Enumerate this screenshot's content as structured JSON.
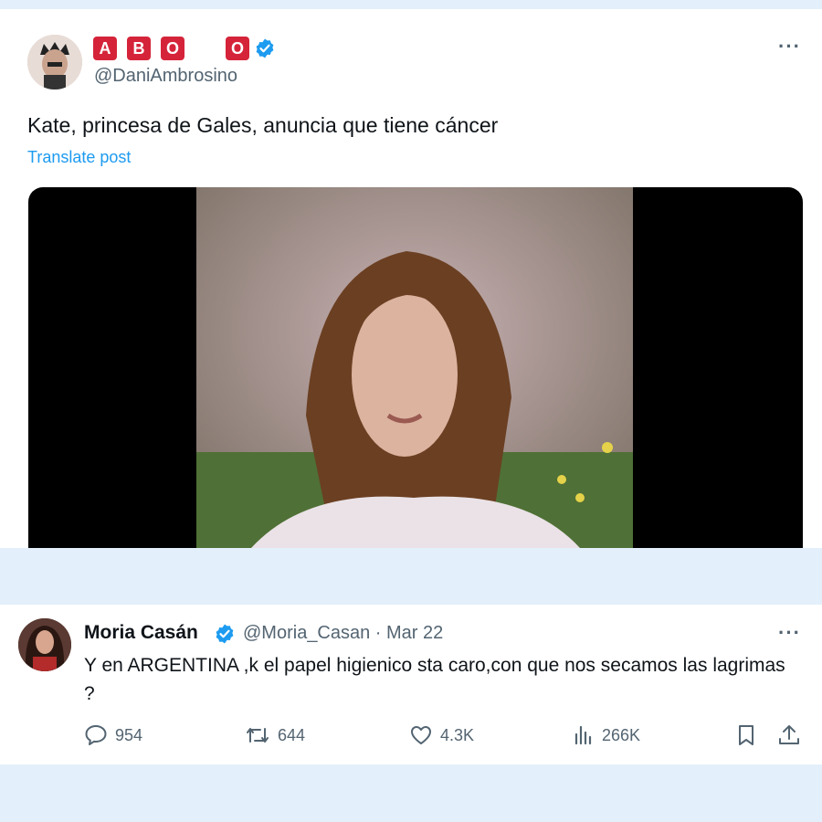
{
  "post": {
    "badges": [
      "A",
      "B",
      "O",
      "O"
    ],
    "handle": "@DaniAmbrosino",
    "text": "Kate, princesa de Gales, anuncia que tiene cáncer",
    "translate_label": "Translate post",
    "more_label": "···"
  },
  "reply": {
    "name": "Moria Casán",
    "handle_date": "@Moria_Casan · Mar 22",
    "text": "Y en ARGENTINA ,k el papel higienico sta caro,con que nos secamos las lagrimas ?",
    "more_label": "···",
    "actions": {
      "replies": "954",
      "reposts": "644",
      "likes": "4.3K",
      "views": "266K"
    }
  },
  "colors": {
    "accent": "#1d9bf0",
    "badge_red": "#d5243a",
    "background": "#e3f0fb"
  }
}
